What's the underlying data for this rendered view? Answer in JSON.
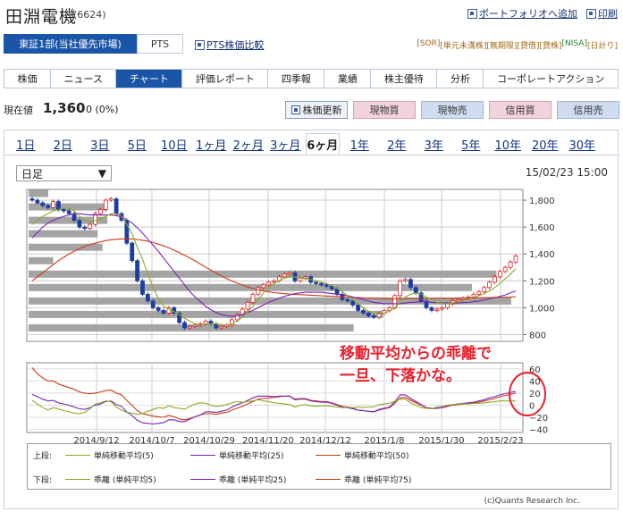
{
  "header": {
    "title": "田淵電機",
    "code": "(6624)",
    "links": [
      "ポートフォリオへ追加",
      "印刷"
    ]
  },
  "market": {
    "primary": "東証1部(当社優先市場)",
    "pts": "PTS",
    "pts_compare": "PTS株価比較"
  },
  "badges": [
    {
      "label": "[SOR]",
      "color": "#a06a1a"
    },
    {
      "label": "[単元未満株]",
      "color": "#a06a1a"
    },
    {
      "label": "[無期限]",
      "color": "#a06a1a"
    },
    {
      "label": "[貸借]",
      "color": "#a06a1a"
    },
    {
      "label": "[貸株]",
      "color": "#a06a1a"
    },
    {
      "label": "[NISA]",
      "color": "#2a7a2a"
    },
    {
      "label": "[日計り]",
      "color": "#a06a1a"
    }
  ],
  "nav": [
    "株価",
    "ニュース",
    "チャート",
    "評価レポート",
    "四季報",
    "業績",
    "株主優待",
    "分析",
    "コーポレートアクション"
  ],
  "nav_active": 2,
  "price": {
    "label": "現在値",
    "value": "1,360",
    "change": "0 (0%)"
  },
  "buttons": {
    "refresh": "株価更新",
    "spot_buy": "現物買",
    "spot_sell": "現物売",
    "margin_buy": "信用買",
    "margin_sell": "信用売"
  },
  "periods": [
    "1日",
    "2日",
    "3日",
    "5日",
    "10日",
    "1ヶ月",
    "2ヶ月",
    "3ヶ月",
    "6ヶ月",
    "1年",
    "2年",
    "3年",
    "5年",
    "10年",
    "20年",
    "30年"
  ],
  "period_active": 8,
  "select": {
    "value": "日足"
  },
  "timestamp": "15/02/23 15:00",
  "chart_data": {
    "type": "line",
    "main": {
      "type": "candlestick",
      "ylim": [
        750,
        1880
      ],
      "yticks": [
        800,
        1000,
        1200,
        1400,
        1600,
        1800
      ],
      "ytick_labels": [
        "800",
        "1,000",
        "1,200",
        "1,400",
        "1,600",
        "1,800"
      ],
      "close": [
        1800,
        1780,
        1760,
        1745,
        1790,
        1730,
        1720,
        1700,
        1650,
        1600,
        1590,
        1620,
        1700,
        1730,
        1800,
        1810,
        1700,
        1650,
        1480,
        1350,
        1200,
        1100,
        1050,
        1000,
        980,
        960,
        1000,
        960,
        890,
        850,
        860,
        870,
        880,
        900,
        880,
        850,
        860,
        870,
        910,
        950,
        990,
        1040,
        1100,
        1150,
        1170,
        1190,
        1200,
        1230,
        1250,
        1260,
        1200,
        1220,
        1230,
        1190,
        1180,
        1170,
        1160,
        1140,
        1100,
        1060,
        1050,
        1020,
        980,
        960,
        940,
        930,
        960,
        980,
        1000,
        1090,
        1200,
        1210,
        1150,
        1110,
        1050,
        1000,
        980,
        990,
        1000,
        1030,
        1050,
        1060,
        1070,
        1080,
        1100,
        1120,
        1150,
        1190,
        1230,
        1270,
        1300,
        1340,
        1385
      ],
      "ma5": [
        1620,
        1650,
        1680,
        1700,
        1720,
        1730,
        1740,
        1740,
        1720,
        1680,
        1650,
        1640,
        1650,
        1660,
        1680,
        1700,
        1700,
        1680,
        1620,
        1550,
        1450,
        1360,
        1250,
        1150,
        1070,
        1010,
        990,
        970,
        950,
        920,
        900,
        880,
        872,
        875,
        880,
        880,
        875,
        870,
        880,
        900,
        930,
        970,
        1010,
        1060,
        1110,
        1150,
        1180,
        1200,
        1220,
        1230,
        1230,
        1220,
        1215,
        1210,
        1200,
        1190,
        1180,
        1165,
        1145,
        1120,
        1090,
        1060,
        1030,
        1000,
        975,
        960,
        955,
        960,
        975,
        1000,
        1040,
        1080,
        1100,
        1110,
        1100,
        1080,
        1060,
        1040,
        1030,
        1030,
        1035,
        1045,
        1055,
        1065,
        1075,
        1090,
        1105,
        1125,
        1150,
        1180,
        1215,
        1250,
        1290
      ],
      "ma25": [
        1520,
        1560,
        1600,
        1630,
        1650,
        1665,
        1680,
        1690,
        1700,
        1700,
        1695,
        1690,
        1690,
        1690,
        1690,
        1690,
        1685,
        1675,
        1655,
        1630,
        1595,
        1555,
        1510,
        1465,
        1420,
        1370,
        1320,
        1270,
        1220,
        1170,
        1120,
        1080,
        1045,
        1010,
        985,
        965,
        950,
        940,
        935,
        940,
        950,
        965,
        980,
        1000,
        1020,
        1040,
        1055,
        1070,
        1085,
        1095,
        1105,
        1110,
        1115,
        1115,
        1115,
        1115,
        1110,
        1105,
        1100,
        1095,
        1090,
        1080,
        1070,
        1060,
        1050,
        1040,
        1035,
        1030,
        1030,
        1030,
        1030,
        1035,
        1040,
        1042,
        1045,
        1045,
        1040,
        1038,
        1036,
        1035,
        1035,
        1035,
        1038,
        1040,
        1045,
        1050,
        1058,
        1066,
        1075,
        1085,
        1095,
        1110,
        1125
      ],
      "ma50": [
        1200,
        1230,
        1260,
        1290,
        1320,
        1350,
        1375,
        1400,
        1420,
        1440,
        1455,
        1470,
        1480,
        1490,
        1500,
        1505,
        1510,
        1512,
        1513,
        1512,
        1508,
        1502,
        1495,
        1485,
        1473,
        1460,
        1445,
        1428,
        1410,
        1390,
        1370,
        1348,
        1325,
        1302,
        1280,
        1258,
        1237,
        1217,
        1199,
        1183,
        1168,
        1155,
        1143,
        1133,
        1125,
        1118,
        1112,
        1108,
        1104,
        1101,
        1099,
        1097,
        1095,
        1093,
        1091,
        1089,
        1087,
        1085,
        1083,
        1081,
        1079,
        1077,
        1075,
        1073,
        1071,
        1070,
        1069,
        1068,
        1067,
        1067,
        1067,
        1067,
        1068,
        1068,
        1069,
        1069,
        1069,
        1069,
        1069,
        1070,
        1070,
        1071,
        1071,
        1072,
        1073,
        1074,
        1075,
        1076,
        1077,
        1078,
        1079,
        1080,
        1082
      ]
    },
    "volume_profile": {
      "type": "horizontal_bar",
      "bins": [
        1850,
        1750,
        1650,
        1550,
        1450,
        1350,
        1250,
        1150,
        1050,
        950,
        850
      ],
      "values": [
        0.04,
        0.16,
        0.16,
        0.14,
        0.15,
        0.05,
        0.95,
        0.9,
        0.98,
        0.72,
        0.66
      ]
    },
    "sub": {
      "ylim": [
        -45,
        70
      ],
      "yticks": [
        60,
        40,
        20,
        0,
        -20,
        -40
      ],
      "ytick_labels": [
        "60",
        "40",
        "20",
        "0",
        "−20",
        "−40"
      ],
      "dev5": [
        8,
        2,
        -4,
        -8,
        -4,
        -6,
        -9,
        -11,
        -13,
        -14,
        -12,
        -6,
        2,
        4,
        7,
        6,
        -3,
        -8,
        -12,
        -13,
        -15,
        -14,
        -10,
        -7,
        -4,
        -5,
        -1,
        -4,
        -5,
        -7,
        -2,
        2,
        4,
        3,
        0,
        -2,
        -1,
        1,
        4,
        6,
        5,
        6,
        7,
        9,
        7,
        6,
        4,
        3,
        2,
        1,
        -3,
        0,
        1,
        -1,
        -2,
        -1,
        -1,
        -2,
        -3,
        -4,
        -3,
        -4,
        -3,
        -4,
        -3,
        -3,
        1,
        2,
        3,
        7,
        10,
        10,
        4,
        0,
        -4,
        -5,
        -6,
        -3,
        -2,
        0,
        1,
        2,
        2,
        2,
        3,
        3,
        4,
        5,
        6,
        7,
        7,
        7,
        7
      ],
      "dev25": [
        18,
        14,
        10,
        7,
        8,
        4,
        2,
        0,
        -3,
        -6,
        -7,
        -4,
        0,
        2,
        6,
        7,
        1,
        -2,
        -11,
        -17,
        -25,
        -29,
        -30,
        -31,
        -30,
        -29,
        -24,
        -24,
        -27,
        -27,
        -23,
        -19,
        -16,
        -11,
        -11,
        -12,
        -10,
        -8,
        -3,
        1,
        4,
        8,
        12,
        15,
        15,
        15,
        14,
        15,
        15,
        15,
        9,
        10,
        10,
        7,
        6,
        5,
        5,
        3,
        0,
        -3,
        -4,
        -6,
        -8,
        -9,
        -10,
        -11,
        -7,
        -5,
        -3,
        6,
        17,
        17,
        11,
        6,
        1,
        -4,
        -6,
        -5,
        -4,
        -1,
        1,
        2,
        3,
        4,
        5,
        7,
        9,
        12,
        14,
        17,
        19,
        21,
        23
      ],
      "dev75": [
        62,
        52,
        45,
        40,
        40,
        35,
        32,
        29,
        26,
        22,
        20,
        19,
        20,
        22,
        24,
        25,
        20,
        17,
        8,
        0,
        -9,
        -14,
        -16,
        -18,
        -19,
        -20,
        -17,
        -19,
        -23,
        -24,
        -22,
        -19,
        -16,
        -14,
        -14,
        -15,
        -13,
        -12,
        -8,
        -5,
        -2,
        2,
        6,
        10,
        11,
        12,
        13,
        14,
        15,
        15,
        10,
        11,
        11,
        8,
        7,
        6,
        6,
        4,
        1,
        -2,
        -3,
        -5,
        -8,
        -9,
        -10,
        -11,
        -8,
        -6,
        -4,
        3,
        12,
        13,
        8,
        4,
        0,
        -4,
        -5,
        -5,
        -4,
        -2,
        0,
        1,
        2,
        3,
        4,
        5,
        7,
        9,
        11,
        14,
        16,
        18,
        20
      ]
    },
    "dates": [
      "2014/9/12",
      "2014/10/7",
      "2014/10/29",
      "2014/11/20",
      "2014/12/12",
      "2015/1/8",
      "2015/1/30",
      "2015/2/23"
    ],
    "colors": {
      "up": "#e0242c",
      "down": "#1d3ea0",
      "ma5": "#8aab22",
      "ma25": "#7a22b8",
      "ma50": "#cc3a16"
    }
  },
  "legend": {
    "row1_label": "上段:",
    "row1": [
      {
        "name": "単純移動平均(5)",
        "color": "#8aab22"
      },
      {
        "name": "単純移動平均(25)",
        "color": "#7a22b8"
      },
      {
        "name": "単純移動平均(50)",
        "color": "#cc3a16"
      }
    ],
    "row2_label": "下段:",
    "row2": [
      {
        "name": "乖離 (単純平均5)",
        "color": "#8aab22"
      },
      {
        "name": "乖離 (単純平均25)",
        "color": "#7a22b8"
      },
      {
        "name": "乖離 (単純平均75)",
        "color": "#cc3a16"
      }
    ]
  },
  "annotation": {
    "line1": "移動平均からの乖離で",
    "line2": "一旦、下落かな。",
    "color": "#e8202c"
  },
  "copyright": "(c)Quants Research Inc."
}
